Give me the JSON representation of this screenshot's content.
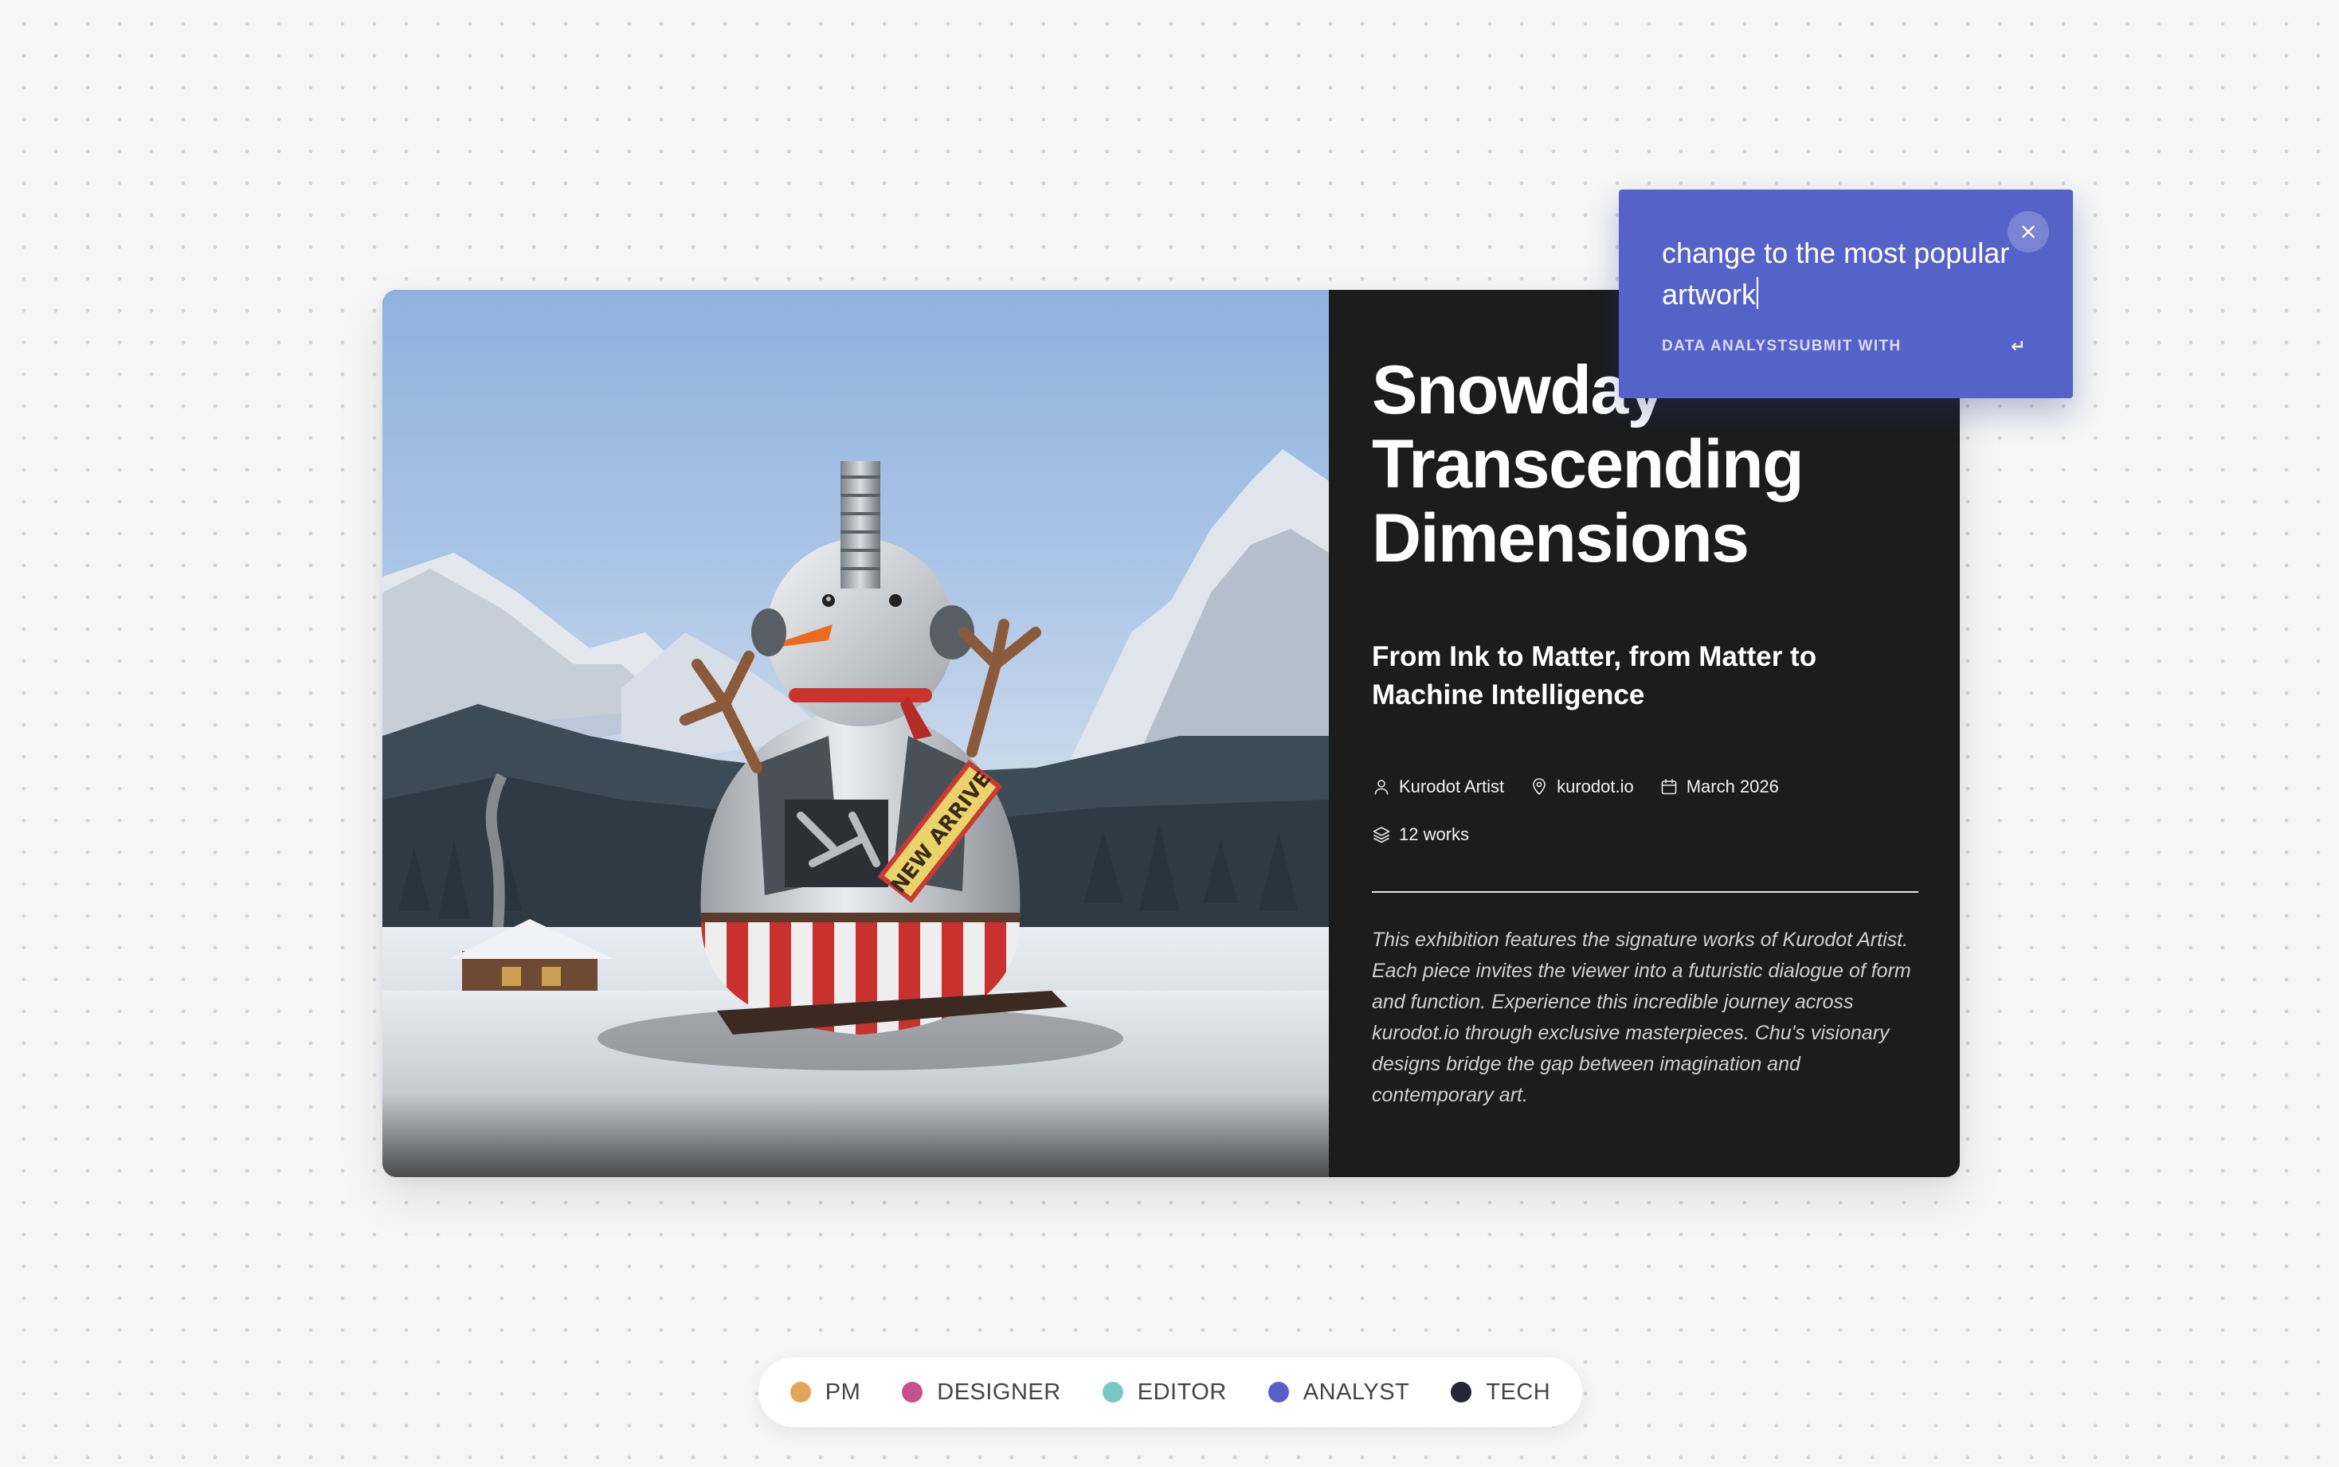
{
  "card": {
    "title": "Snowday\nTranscending\nDimensions",
    "subtitle": "From Ink to Matter, from Matter to Machine Intelligence",
    "meta": {
      "artist": "Kurodot Artist",
      "location": "kurodot.io",
      "date": "March 2026",
      "works": "12 works"
    },
    "description": "This exhibition features the signature works of Kurodot Artist. Each piece invites the viewer into a futuristic dialogue of form and function. Experience this incredible journey across kurodot.io through exclusive masterpieces. Chu's visionary designs bridge the gap between imagination and contemporary art.",
    "image_badge": "NEW ARRIVE"
  },
  "popover": {
    "input_text": "change to the most popular artwork",
    "footer_left": "DATA ANALYSTSUBMIT WITH",
    "footer_right": "↵",
    "bg_color": "#5562c8"
  },
  "icons": {
    "artist": "user-icon",
    "location": "map-pin-icon",
    "date": "calendar-icon",
    "works": "layers-icon",
    "close": "close-icon"
  },
  "legend": {
    "items": [
      {
        "label": "PM",
        "color": "#e6a35a"
      },
      {
        "label": "DESIGNER",
        "color": "#c6508a"
      },
      {
        "label": "EDITOR",
        "color": "#78c8c4"
      },
      {
        "label": "ANALYST",
        "color": "#5561c7"
      },
      {
        "label": "TECH",
        "color": "#262637"
      }
    ]
  }
}
